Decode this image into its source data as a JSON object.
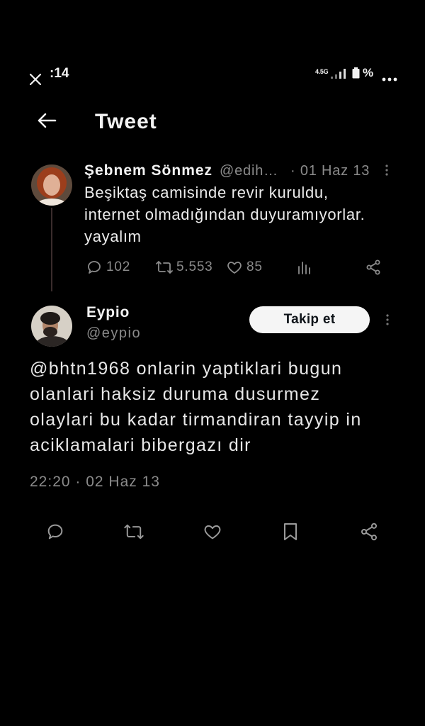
{
  "theme": {
    "bg": "#000000",
    "text": "#e7e7e7",
    "strong": "#f2f2f2",
    "muted": "#8b8b8b",
    "line": "#3a2c2c",
    "btn-bg": "#f5f5f5",
    "btn-text": "#0f1419",
    "icon": "#8b8b8b",
    "icon-bar": "#9a9a9a"
  },
  "status_bar": {
    "time": ":14",
    "network_type": "4.5G",
    "battery_percent": "%",
    "icons": [
      "close-icon",
      "signal-bars-icon",
      "battery-icon",
      "more-dots-icon"
    ]
  },
  "header": {
    "title": "Tweet",
    "back_icon": "arrow-left-icon"
  },
  "parent_tweet": {
    "author_name": "Şebnem Sönmez",
    "author_handle": "@edih…",
    "date": "· 01 Haz 13",
    "text_lines": [
      "Beşiktaş camisinde revir kuruldu,",
      "internet olmadığından duyuramıyorlar.",
      "yayalım"
    ],
    "stats": {
      "replies": "102",
      "retweets": "5.553",
      "likes": "85"
    },
    "action_icons": [
      "reply-icon",
      "retweet-icon",
      "heart-icon",
      "analytics-icon",
      "share-icon"
    ]
  },
  "main_tweet": {
    "author_name": "Eypio",
    "author_handle": "@eypio",
    "follow_label": "Takip et",
    "text_lines": [
      "@bhtn1968 onlarin yaptiklari bugun",
      "olanlari haksiz duruma dusurmez",
      "olaylari bu kadar tirmandiran tayyip in",
      "aciklamalari bibergazı dir"
    ],
    "timestamp": "22:20 · 02 Haz 13",
    "action_icons": [
      "reply-icon",
      "retweet-icon",
      "heart-icon",
      "bookmark-icon",
      "share-icon"
    ]
  }
}
